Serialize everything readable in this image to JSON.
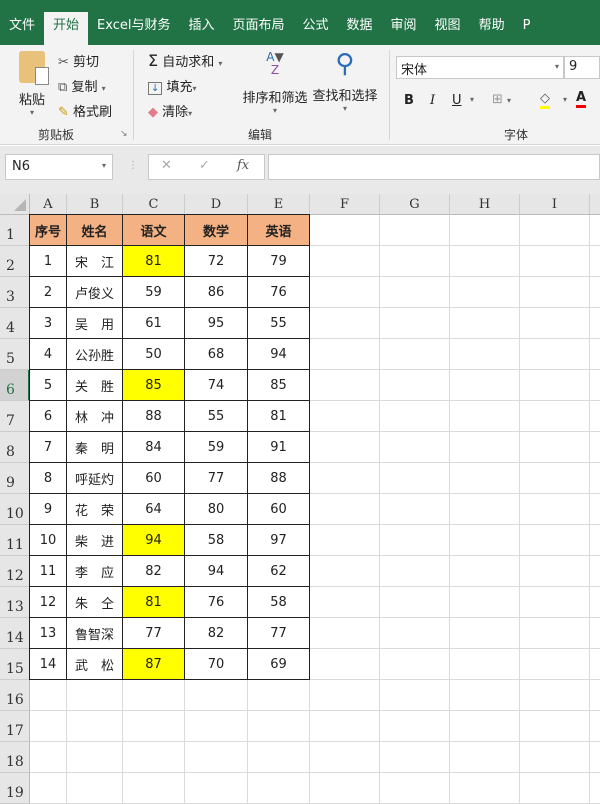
{
  "tabs": [
    "文件",
    "开始",
    "Excel与财务",
    "插入",
    "页面布局",
    "公式",
    "数据",
    "审阅",
    "视图",
    "帮助",
    "P"
  ],
  "active_tab": "开始",
  "ribbon": {
    "clipboard": {
      "paste": "粘贴",
      "cut": "剪切",
      "copy": "复制",
      "format_painter": "格式刷",
      "group": "剪贴板"
    },
    "editing": {
      "autosum": "自动求和",
      "fill": "填充",
      "clear": "清除",
      "sort_filter": "排序和筛选",
      "find_select": "查找和选择",
      "group": "编辑"
    },
    "font": {
      "font_name": "宋体",
      "font_size": "9",
      "bold": "B",
      "italic": "I",
      "underline": "U",
      "font_color": "A",
      "group": "字体"
    }
  },
  "formula_bar": {
    "name_box": "N6",
    "cancel": "✕",
    "enter": "✓",
    "fx": "fx",
    "formula": ""
  },
  "columns": [
    "A",
    "B",
    "C",
    "D",
    "E",
    "F",
    "G",
    "H",
    "I"
  ],
  "row_numbers": [
    "1",
    "2",
    "3",
    "4",
    "5",
    "6",
    "7",
    "8",
    "9",
    "10",
    "11",
    "12",
    "13",
    "14",
    "15",
    "16",
    "17",
    "18",
    "19"
  ],
  "selected_row": "6",
  "colors": {
    "header_fill": "#f4b183",
    "highlight_fill": "#ffff00",
    "ribbon_green": "#217346"
  },
  "table": {
    "headers": [
      "序号",
      "姓名",
      "语文",
      "数学",
      "英语"
    ],
    "rows": [
      [
        "1",
        "宋　江",
        "81",
        "72",
        "79"
      ],
      [
        "2",
        "卢俊义",
        "59",
        "86",
        "76"
      ],
      [
        "3",
        "吴　用",
        "61",
        "95",
        "55"
      ],
      [
        "4",
        "公孙胜",
        "50",
        "68",
        "94"
      ],
      [
        "5",
        "关　胜",
        "85",
        "74",
        "85"
      ],
      [
        "6",
        "林　冲",
        "88",
        "55",
        "81"
      ],
      [
        "7",
        "秦　明",
        "84",
        "59",
        "91"
      ],
      [
        "8",
        "呼延灼",
        "60",
        "77",
        "88"
      ],
      [
        "9",
        "花　荣",
        "64",
        "80",
        "60"
      ],
      [
        "10",
        "柴　进",
        "94",
        "58",
        "97"
      ],
      [
        "11",
        "李　应",
        "82",
        "94",
        "62"
      ],
      [
        "12",
        "朱　仝",
        "81",
        "76",
        "58"
      ],
      [
        "13",
        "鲁智深",
        "77",
        "82",
        "77"
      ],
      [
        "14",
        "武　松",
        "87",
        "70",
        "69"
      ]
    ],
    "highlighted_chinese_rows": [
      1,
      5,
      10,
      12,
      14
    ]
  }
}
